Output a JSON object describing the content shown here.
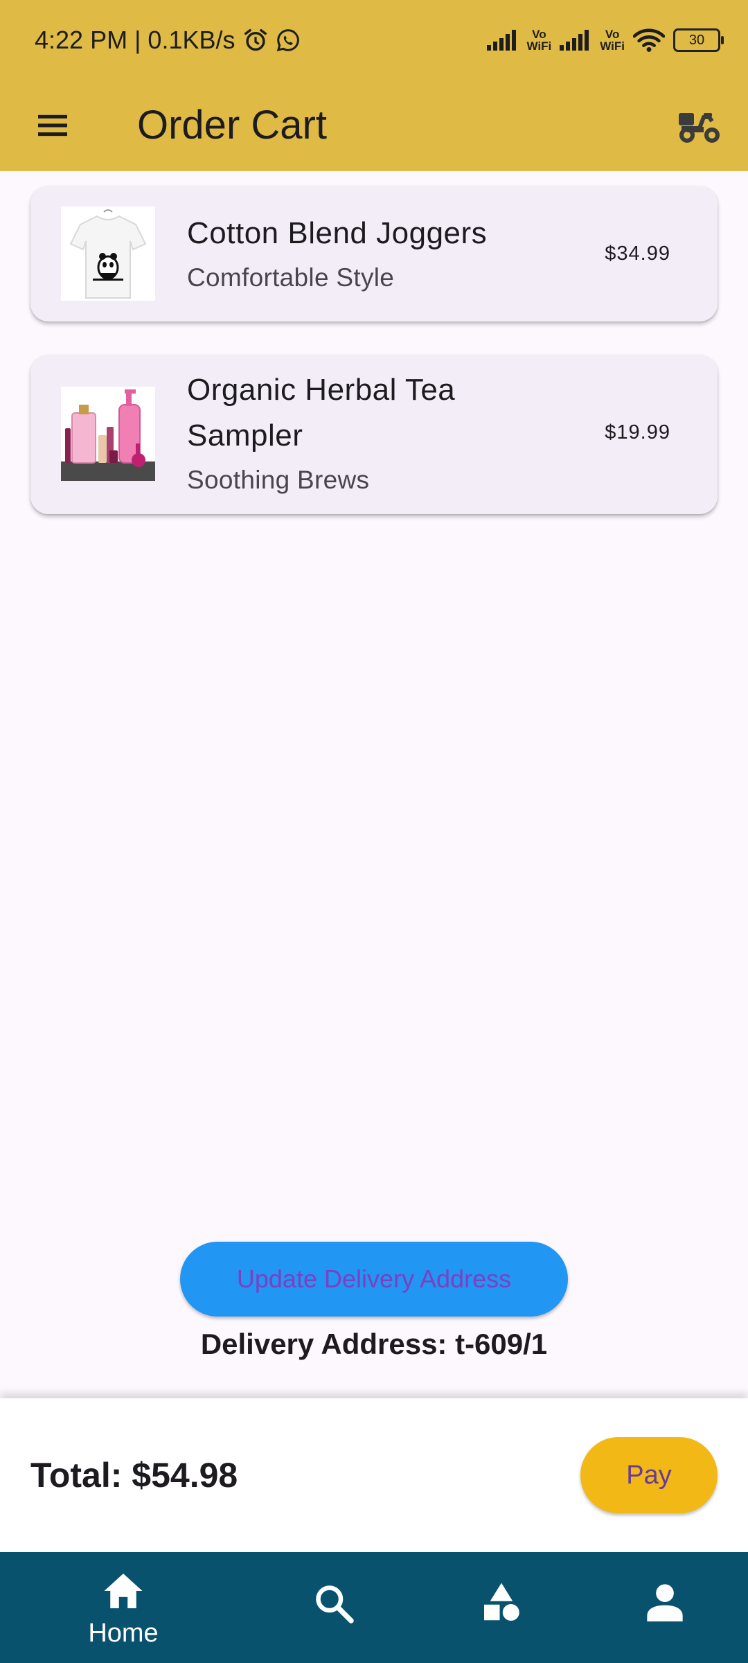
{
  "status_bar": {
    "time": "4:22 PM | 0.1KB/s",
    "vowifi_1": "Vo\nWiFi",
    "vowifi_2": "Vo\nWiFi",
    "battery": "30"
  },
  "app_bar": {
    "title": "Order Cart",
    "menu_icon": "menu-icon",
    "action_icon": "delivery-scooter-icon"
  },
  "cart": {
    "items": [
      {
        "title": "Cotton Blend Joggers",
        "subtitle": "Comfortable Style",
        "price": "$34.99"
      },
      {
        "title": "Organic Herbal Tea Sampler",
        "title_line1": "Organic Herbal Tea",
        "title_line2": "Sampler",
        "subtitle": "Soothing Brews",
        "price": "$19.99"
      }
    ]
  },
  "delivery": {
    "button_label": "Update Delivery Address",
    "address_text": "Delivery Address: t-609/1"
  },
  "checkout": {
    "total_label": "Total: $54.98",
    "pay_label": "Pay"
  },
  "bottom_nav": {
    "home_label": "Home",
    "items": [
      "home-icon",
      "search-icon",
      "categories-icon",
      "profile-icon"
    ]
  },
  "colors": {
    "app_bar": "#DFBA44",
    "card": "#F3EDF7",
    "address_button": "#2196F3",
    "pay_button": "#F2B816",
    "bottom_nav": "#08526D"
  }
}
